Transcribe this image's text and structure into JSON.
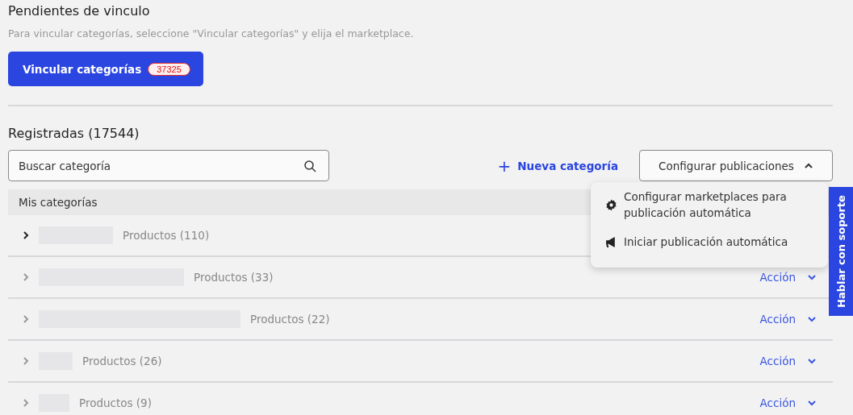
{
  "pending": {
    "title": "Pendientes de vinculo",
    "hint": "Para vincular categorías, seleccione \"Vincular categorías\" y elija el marketplace.",
    "button": {
      "label": "Vincular categorías",
      "badge": "37325"
    }
  },
  "registered": {
    "title": "Registradas (17544)",
    "search": {
      "placeholder": "Buscar categoría"
    },
    "new_button": {
      "icon": "+",
      "label": "Nueva categoría"
    },
    "config_button": {
      "label": "Configurar publicaciones",
      "expanded": true
    }
  },
  "menu": [
    {
      "kind": "settings",
      "label": "Configurar marketplaces para publicación automática"
    },
    {
      "kind": "announce",
      "label": "Iniciar publicación automática"
    }
  ],
  "table": {
    "header": "Mis categorías",
    "rows": [
      {
        "count": "Productos (110)",
        "hovered": true
      },
      {
        "count": "Productos (33)",
        "hovered": false,
        "action": "Acción"
      },
      {
        "count": "Productos (22)",
        "hovered": false,
        "action": "Acción"
      },
      {
        "count": "Productos (26)",
        "hovered": false,
        "action": "Acción"
      },
      {
        "count": "Productos (9)",
        "hovered": false,
        "action": "Acción"
      }
    ]
  },
  "support_tab": "Hablar con soporte"
}
